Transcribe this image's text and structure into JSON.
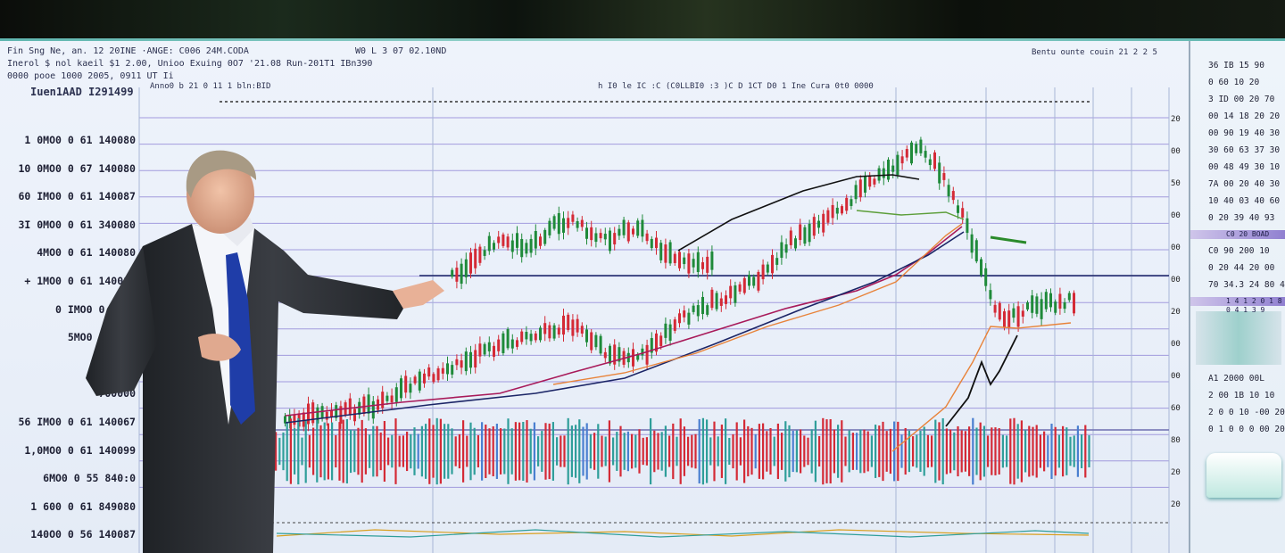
{
  "header": {
    "line1": "Fin Sng Ne, an. 12 20INE  ·ANGE: C006 24M.CODA",
    "line2": "Inerol $ nol kaeil $1 2.00, Unioo  Exuing  0O7 '21.08 Run-201T1 IBn390",
    "line3": "0000 pooe 1000 2005, 0911 UT Ii",
    "line4": "Iuen1AAD I291499",
    "center_top": "W0 L 3  07 02.10ND",
    "chart_caption": "h  I0  le  IC  :C  (C0LLBI0  :3  )C  D  1CT  D0  1  Ine  Cura  0t0  0000",
    "left_caption": "Anno0 b 21  0 11 1 bln:BID",
    "top_right": "Bentu ounte  couin 21  2  2  5"
  },
  "price_axis_left": [
    "1 0MO0 0 61 140080",
    "10 0MO0 0 67 140080",
    "60 IMO0 0 61 140087",
    "3I 0MO0 0 61 340080",
    "4MO0 0 61 140080",
    "+ 1MO0 0 61 140080",
    "0 IMO0 0 61 1",
    "5MO0 0 61 1",
    "00:0..",
    "700000",
    "56 IMO0 0 61 140067",
    "1,0MO0 0 61 140099",
    "6MO0 0 55 840:0",
    "1 600 0 61 849080",
    "140O0 0 56 140087"
  ],
  "price_axis_right": [
    "20",
    "00",
    "50",
    "00",
    "00",
    "00",
    "20",
    "00",
    "00",
    "60",
    "80",
    "20",
    "20"
  ],
  "right_panel": {
    "rows_top": [
      "36 IB 15 90",
      "0 60 10 20",
      "3 ID 00  20  70",
      "00 14  18 20 20",
      "00  90 19 40 30",
      "30 60 63 37 30",
      "00 48 49 30 10",
      "7A 00 20 40 30",
      "10 40 03 40 60",
      "0 20 39 40 93"
    ],
    "band_1": "C0 20 BOAD",
    "rows_mid": [
      "C0 90 200 10",
      "0 20 44 20 00",
      "70 34.3 24 80 40"
    ],
    "band_2": "1 4 1 2 0 1 8 0 4 1 3 9",
    "rows_bot": [
      "A1  2000 00L",
      "2 00 1B 10 10",
      "2 0 0 10 -00 20",
      "0 1 0 0 0 00 20"
    ]
  },
  "colors": {
    "up": "#1f8a3a",
    "down": "#d42a36",
    "vol_teal": "#2f9e9a",
    "ma_navy": "#1b2566",
    "ma_orange": "#e8833a",
    "ma_green": "#5c9e3a",
    "suit": "#2d3035",
    "tie": "#1f3da8"
  },
  "figure": {
    "description_icon": "presenter-person"
  },
  "chart_data": {
    "type": "line",
    "title": "",
    "xlabel": "",
    "ylabel": "",
    "series": [
      {
        "values": [
          20,
          22,
          26,
          30,
          36,
          42,
          50,
          58,
          54,
          49,
          50,
          56,
          63,
          72,
          85,
          95,
          70,
          40,
          36,
          38,
          41
        ]
      },
      {
        "values": [
          18,
          20,
          24,
          28,
          33,
          39,
          46,
          53,
          51,
          48,
          49,
          54,
          61,
          70,
          82,
          90,
          72,
          45,
          38,
          40,
          42
        ]
      }
    ]
  }
}
